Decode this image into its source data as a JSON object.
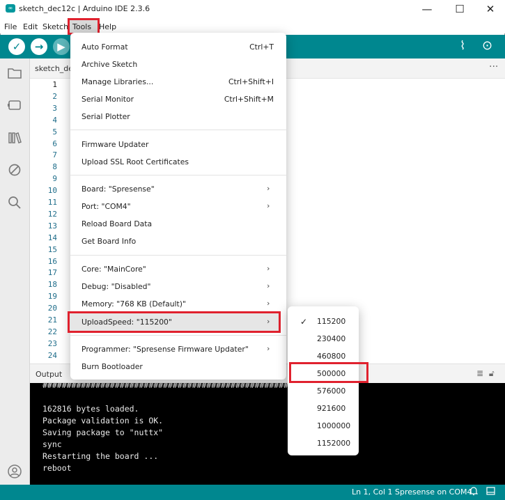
{
  "window": {
    "title": "sketch_dec12c | Arduino IDE 2.3.6",
    "app_icon": "∞",
    "controls": [
      "—",
      "☐",
      "✕"
    ]
  },
  "menubar": [
    "File",
    "Edit",
    "Sketch",
    "Tools",
    "Help"
  ],
  "toolbar": {
    "verify_icon": "✓",
    "upload_icon": "→",
    "debug_icon": "▶",
    "serial_plotter_icon": "⌇",
    "serial_monitor_icon": "⊙"
  },
  "editor": {
    "tab_name": "sketch_de",
    "more_icon": "···",
    "line_numbers": [
      "1",
      "2",
      "3",
      "4",
      "5",
      "6",
      "7",
      "8",
      "9",
      "10",
      "11",
      "12",
      "13",
      "14",
      "15",
      "16",
      "17",
      "18",
      "19",
      "20",
      "21",
      "22",
      "23",
      "24"
    ]
  },
  "tools_menu": {
    "items": [
      {
        "label": "Auto Format",
        "shortcut": "Ctrl+T"
      },
      {
        "label": "Archive Sketch",
        "shortcut": ""
      },
      {
        "label": "Manage Libraries...",
        "shortcut": "Ctrl+Shift+I"
      },
      {
        "label": "Serial Monitor",
        "shortcut": "Ctrl+Shift+M"
      },
      {
        "label": "Serial Plotter",
        "shortcut": ""
      },
      {
        "label": "Firmware Updater",
        "shortcut": ""
      },
      {
        "label": "Upload SSL Root Certificates",
        "shortcut": ""
      },
      {
        "label": "Board: \"Spresense\"",
        "shortcut": ""
      },
      {
        "label": "Port: \"COM4\"",
        "shortcut": ""
      },
      {
        "label": "Reload Board Data",
        "shortcut": ""
      },
      {
        "label": "Get Board Info",
        "shortcut": ""
      },
      {
        "label": "Core: \"MainCore\"",
        "shortcut": ""
      },
      {
        "label": "Debug: \"Disabled\"",
        "shortcut": ""
      },
      {
        "label": "Memory: \"768 KB (Default)\"",
        "shortcut": ""
      },
      {
        "label": "UploadSpeed: \"115200\"",
        "shortcut": ""
      },
      {
        "label": "Programmer: \"Spresense Firmware Updater\"",
        "shortcut": ""
      },
      {
        "label": "Burn Bootloader",
        "shortcut": ""
      }
    ],
    "submenu_arrow": "›"
  },
  "upload_speed_submenu": {
    "options": [
      "115200",
      "230400",
      "460800",
      "500000",
      "576000",
      "921600",
      "1000000",
      "1152000"
    ],
    "selected": "115200",
    "check_icon": "✓"
  },
  "output": {
    "label": "Output",
    "lines": [
      "##########################################################",
      "",
      "162816 bytes loaded.",
      "Package validation is OK.",
      "Saving package to \"nuttx\"",
      "sync",
      "Restarting the board ...",
      "reboot"
    ]
  },
  "statusbar": {
    "position": "Ln 1, Col 1",
    "board": "Spresense on COM4"
  }
}
